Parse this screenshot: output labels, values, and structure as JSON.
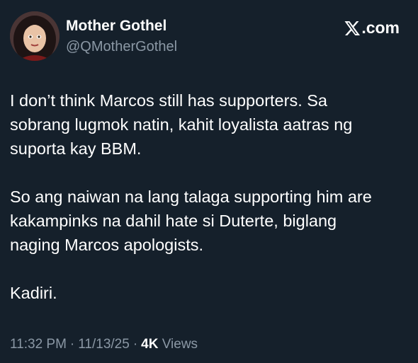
{
  "author": {
    "name": "Mother Gothel",
    "handle": "@QMotherGothel"
  },
  "brand": {
    "label": ".com",
    "icon": "x-logo-icon"
  },
  "tweet": {
    "paragraphs": [
      "I don’t think Marcos still has supporters. Sa\nsobrang lugmok natin, kahit loyalista aatras ng\nsuporta kay BBM.",
      "So ang naiwan na lang talaga supporting him are\nkakampinks na dahil hate si Duterte, biglang\nnaging Marcos apologists.",
      "Kadiri."
    ]
  },
  "meta": {
    "time": "11:32 PM",
    "date": "11/13/25",
    "separator": "·",
    "views_count": "4K",
    "views_label": "Views"
  },
  "colors": {
    "background": "#15202b",
    "text": "#ffffff",
    "muted": "#8b98a5"
  }
}
